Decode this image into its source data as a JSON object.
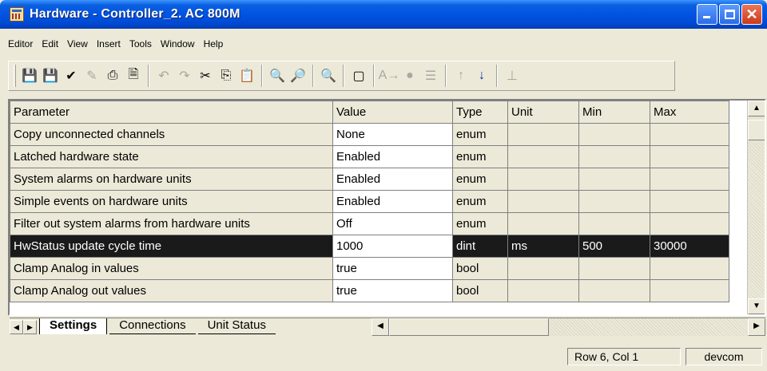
{
  "window": {
    "title": "Hardware - Controller_2. AC 800M",
    "icon": "hardware-editor-icon"
  },
  "menu": [
    "Editor",
    "Edit",
    "View",
    "Insert",
    "Tools",
    "Window",
    "Help"
  ],
  "toolbar": {
    "buttons": [
      {
        "icon": "save-icon",
        "glyph": "💾"
      },
      {
        "icon": "save-all-icon",
        "glyph": "💾"
      },
      {
        "icon": "check-icon",
        "glyph": "✔"
      },
      {
        "icon": "compile-icon",
        "glyph": "✎"
      },
      {
        "icon": "print-icon",
        "glyph": "⎙"
      },
      {
        "icon": "print-preview-icon",
        "glyph": "🗎"
      },
      {
        "icon": "undo-icon",
        "glyph": "↶"
      },
      {
        "icon": "redo-icon",
        "glyph": "↷"
      },
      {
        "icon": "cut-icon",
        "glyph": "✂"
      },
      {
        "icon": "copy-icon",
        "glyph": "⎘"
      },
      {
        "icon": "paste-icon",
        "glyph": "📋"
      },
      {
        "icon": "find-icon",
        "glyph": "🔍"
      },
      {
        "icon": "find-next-icon",
        "glyph": "🔎"
      },
      {
        "icon": "find-replace-icon",
        "glyph": "🔍"
      },
      {
        "icon": "interaction-window-icon",
        "glyph": "▢"
      },
      {
        "icon": "rename-icon",
        "glyph": "A→"
      },
      {
        "icon": "breakpoint-icon",
        "glyph": "●"
      },
      {
        "icon": "tree-icon",
        "glyph": "☰"
      },
      {
        "icon": "arrow-up-icon",
        "glyph": "↑"
      },
      {
        "icon": "arrow-down-icon",
        "glyph": "↓"
      },
      {
        "icon": "anchor-icon",
        "glyph": "⊥"
      }
    ]
  },
  "grid": {
    "columns": [
      "Parameter",
      "Value",
      "Type",
      "Unit",
      "Min",
      "Max"
    ],
    "rows": [
      {
        "parameter": "Copy unconnected channels",
        "value": "None",
        "type": "enum",
        "unit": "",
        "min": "",
        "max": ""
      },
      {
        "parameter": "Latched hardware state",
        "value": "Enabled",
        "type": "enum",
        "unit": "",
        "min": "",
        "max": ""
      },
      {
        "parameter": "System alarms on hardware units",
        "value": "Enabled",
        "type": "enum",
        "unit": "",
        "min": "",
        "max": ""
      },
      {
        "parameter": "Simple events on hardware units",
        "value": "Enabled",
        "type": "enum",
        "unit": "",
        "min": "",
        "max": ""
      },
      {
        "parameter": "Filter out system alarms from hardware units",
        "value": "Off",
        "type": "enum",
        "unit": "",
        "min": "",
        "max": ""
      },
      {
        "parameter": "HwStatus update cycle time",
        "value": "1000",
        "type": "dint",
        "unit": "ms",
        "min": "500",
        "max": "30000",
        "selected": true
      },
      {
        "parameter": "Clamp Analog in values",
        "value": "true",
        "type": "bool",
        "unit": "",
        "min": "",
        "max": ""
      },
      {
        "parameter": "Clamp Analog out values",
        "value": "true",
        "type": "bool",
        "unit": "",
        "min": "",
        "max": ""
      }
    ]
  },
  "tabs": [
    {
      "label": "Settings",
      "active": true
    },
    {
      "label": "Connections",
      "active": false
    },
    {
      "label": "Unit Status",
      "active": false
    }
  ],
  "status": {
    "position": "Row 6, Col 1",
    "user": "devcom"
  },
  "colors": {
    "title_bar": "#0054e3",
    "selected_row": "#1a1a1a",
    "chrome": "#ece9d8"
  }
}
